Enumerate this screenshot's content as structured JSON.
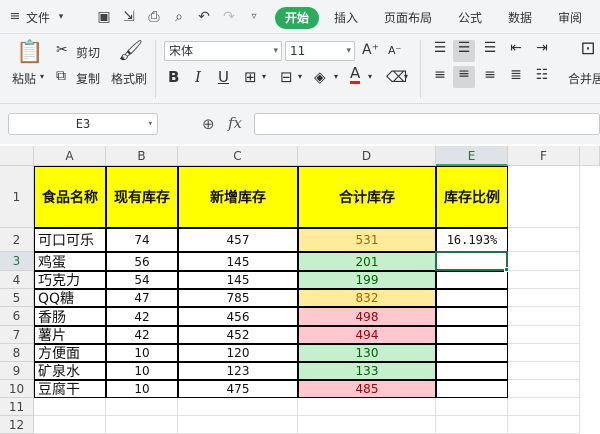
{
  "menubar": {
    "file_label": "文件",
    "tabs": [
      "开始",
      "插入",
      "页面布局",
      "公式",
      "数据",
      "审阅"
    ]
  },
  "ribbon": {
    "paste": "粘贴",
    "cut": "剪切",
    "copy": "复制",
    "format_painter": "格式刷",
    "font_name": "宋体",
    "font_size": "11",
    "bold": "B",
    "italic": "I",
    "underline": "U",
    "font_color_glyph": "A",
    "merge_center": "合并居"
  },
  "formula_bar": {
    "name_box": "E3",
    "fx": "fx",
    "value": ""
  },
  "columns": [
    "A",
    "B",
    "C",
    "D",
    "E",
    "F"
  ],
  "rows": [
    "1",
    "2",
    "3",
    "4",
    "5",
    "6",
    "7",
    "8",
    "9",
    "10",
    "11",
    "12"
  ],
  "headers": [
    "食品名称",
    "现有库存",
    "新增库存",
    "合计库存",
    "库存比例"
  ],
  "data": [
    {
      "name": "可口可乐",
      "stock": "74",
      "added": "457",
      "total": "531",
      "ratio": "16.193%"
    },
    {
      "name": "鸡蛋",
      "stock": "56",
      "added": "145",
      "total": "201",
      "ratio": ""
    },
    {
      "name": "巧克力",
      "stock": "54",
      "added": "145",
      "total": "199",
      "ratio": ""
    },
    {
      "name": "QQ糖",
      "stock": "47",
      "added": "785",
      "total": "832",
      "ratio": ""
    },
    {
      "name": "香肠",
      "stock": "42",
      "added": "456",
      "total": "498",
      "ratio": ""
    },
    {
      "name": "薯片",
      "stock": "42",
      "added": "452",
      "total": "494",
      "ratio": ""
    },
    {
      "name": "方便面",
      "stock": "10",
      "added": "120",
      "total": "130",
      "ratio": ""
    },
    {
      "name": "矿泉水",
      "stock": "10",
      "added": "123",
      "total": "133",
      "ratio": ""
    },
    {
      "name": "豆腐干",
      "stock": "10",
      "added": "475",
      "total": "485",
      "ratio": ""
    }
  ],
  "colors": {
    "header_fill": "#ffff00",
    "accent": "#2bab5e",
    "yellow_fill": "#ffeb9c",
    "yellow_text": "#9c6500",
    "green_fill": "#c6efce",
    "green_text": "#006100",
    "red_fill": "#ffc7ce",
    "red_text": "#9c0006"
  },
  "total_fill": [
    "yellow",
    "green",
    "green",
    "yellow",
    "red",
    "red",
    "green",
    "green",
    "red"
  ]
}
